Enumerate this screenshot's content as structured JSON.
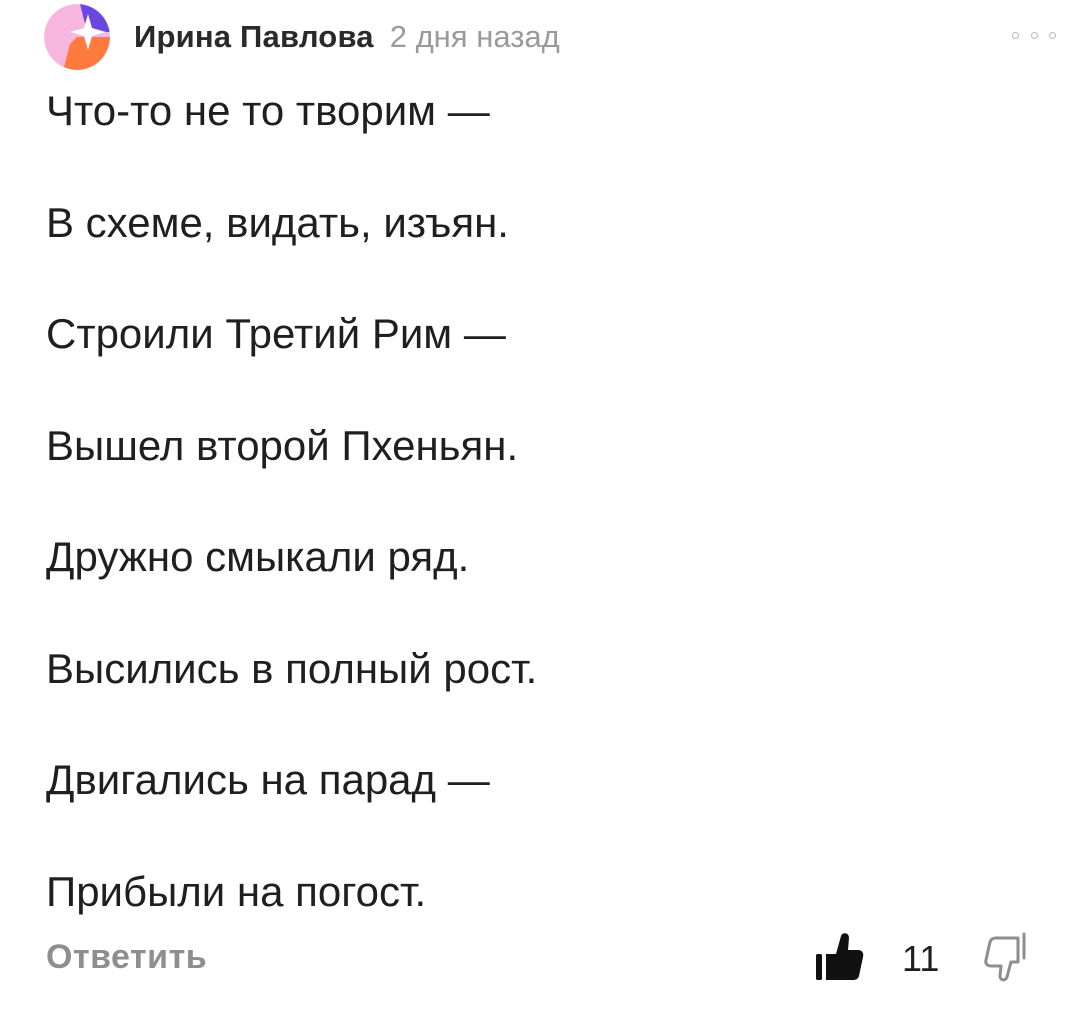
{
  "comment": {
    "author": "Ирина Павлова",
    "time": "2 дня назад",
    "avatar_icon": "avatar-logo-icon",
    "more_icon": "more-dots-icon",
    "poem_lines": [
      "Что-то не то творим —",
      "В схеме, видать, изъян.",
      "Строили Третий Рим —",
      "Вышел второй Пхеньян.",
      "Дружно смыкали ряд.",
      "Высились в полный рост.",
      "Двигались на парад —",
      "Прибыли на погост."
    ],
    "reply_label": "Ответить",
    "likes": "11",
    "like_icon": "thumbs-up-icon",
    "dislike_icon": "thumbs-down-icon"
  },
  "colors": {
    "avatar_pink": "#f7b6de",
    "avatar_orange": "#ff7a3d",
    "avatar_purple": "#6b46e0",
    "muted_text": "#8e8e8e"
  }
}
